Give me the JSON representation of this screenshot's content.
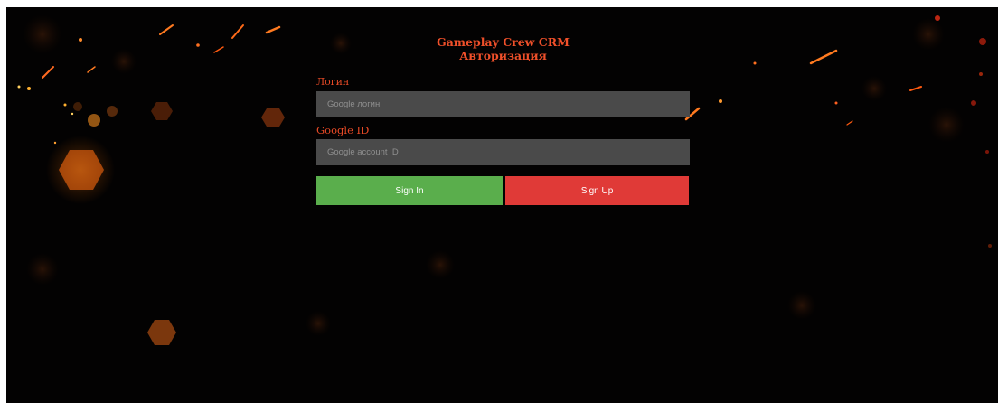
{
  "app": {
    "title": "Gameplay Crew CRM",
    "subtitle": "Авторизация"
  },
  "form": {
    "login_label": "Логин",
    "login_placeholder": "Google логин",
    "login_value": "",
    "google_id_label": "Google ID",
    "google_id_placeholder": "Google account ID",
    "google_id_value": "",
    "sign_in_label": "Sign In",
    "sign_up_label": "Sign Up"
  },
  "colors": {
    "background": "#030202",
    "accent_text": "#f0502a",
    "input_bg": "#4a4a4a",
    "sign_in_bg": "#5aae4c",
    "sign_up_bg": "#e03a37"
  }
}
